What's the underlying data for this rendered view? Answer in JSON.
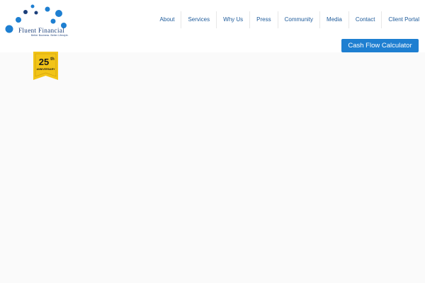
{
  "logo": {
    "name": "Fluent Financial",
    "tagline": "Better Business. Better Lifestyle."
  },
  "nav": {
    "items": [
      {
        "label": "About"
      },
      {
        "label": "Services"
      },
      {
        "label": "Why Us"
      },
      {
        "label": "Press"
      },
      {
        "label": "Community"
      },
      {
        "label": "Media"
      },
      {
        "label": "Contact"
      },
      {
        "label": "Client Portal"
      }
    ]
  },
  "cta": {
    "label": "Cash Flow Calculator"
  },
  "badge": {
    "number": "25",
    "suffix": "th",
    "label": "ANNIVERSARY"
  },
  "colors": {
    "brand_dark": "#1b3f7a",
    "brand_blue": "#1e7fd1",
    "nav_text": "#1d5a9a",
    "badge_gold": "#f2c418",
    "page_background": "#fafafa"
  }
}
